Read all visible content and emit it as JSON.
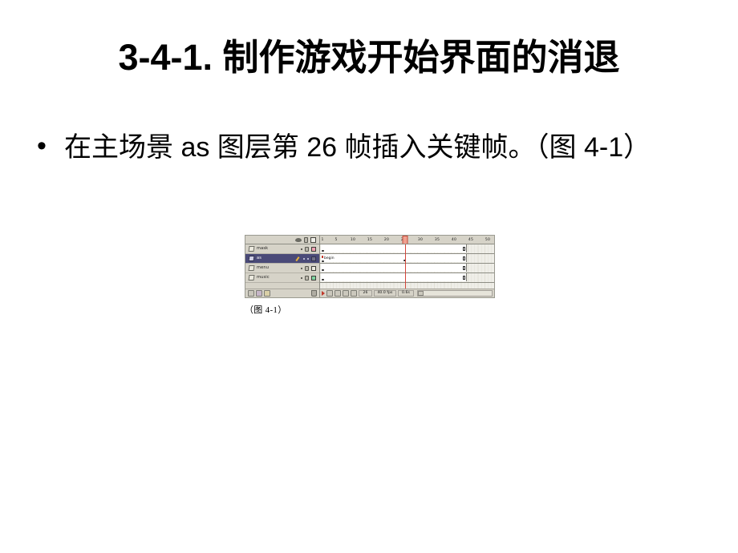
{
  "slide": {
    "title": "3-4-1. 制作游戏开始界面的消退",
    "bullets": [
      {
        "marker": "•",
        "text": "在主场景 as 图层第 26 帧插入关键帧。（图 4-1）"
      }
    ],
    "figure": {
      "caption": "（图 4-1）",
      "alt_name": "flash-timeline-panel"
    }
  },
  "timeline": {
    "column_headers": {
      "eye": "eye-icon",
      "lock": "lock-icon",
      "outline": "outline-square-icon"
    },
    "layers": [
      {
        "name": "mask",
        "selected": false,
        "edit_marker": "dot",
        "visible_dot": "•",
        "locked_icon": "lock-icon",
        "outline_color": "#f3a0b4",
        "span_start": 1,
        "span_end": 45,
        "keyframes": [
          1
        ],
        "empty_keyframes": [],
        "label": ""
      },
      {
        "name": "as",
        "selected": true,
        "edit_marker": "pencil-icon",
        "visible_dot": "•",
        "locked_icon": "dot",
        "outline_color": "#6f6f86",
        "span_start": 1,
        "span_end": 45,
        "keyframes": [
          1,
          26
        ],
        "empty_keyframes": [],
        "label": "begin"
      },
      {
        "name": "menu",
        "selected": false,
        "edit_marker": "dot",
        "visible_dot": "•",
        "locked_icon": "lock-icon",
        "outline_color": "#eceadf",
        "span_start": 1,
        "span_end": 45,
        "keyframes": [
          1
        ],
        "empty_keyframes": [],
        "label": ""
      },
      {
        "name": "music",
        "selected": false,
        "edit_marker": "dot",
        "visible_dot": "•",
        "locked_icon": "lock-icon",
        "outline_color": "#7fd4a0",
        "span_start": 1,
        "span_end": 45,
        "keyframes": [
          1
        ],
        "empty_keyframes": [],
        "label": ""
      }
    ],
    "layer_toolbar": {
      "insert_layer": "insert-layer-icon",
      "add_motion_guide": "add-motion-guide-icon",
      "insert_layer_folder": "insert-layer-folder-icon",
      "delete_layer": "trash-icon"
    },
    "ruler": {
      "ticks": [
        1,
        5,
        10,
        15,
        20,
        25,
        30,
        35,
        40,
        45,
        50
      ],
      "first_frame": 1,
      "last_frame": 52
    },
    "playhead_frame": 26,
    "status_bar": {
      "play_icon": "play-icon",
      "buttons": [
        "center-frame-icon",
        "onion-skin-icon",
        "onion-skin-outlines-icon",
        "edit-multiple-frames-icon",
        "modify-onion-markers-icon"
      ],
      "current_frame": "26",
      "frame_rate": "40.0 fps",
      "elapsed_time": "0.6s",
      "scroll_left_icon": "scroll-left-icon"
    }
  },
  "colors": {
    "page_background": "#ffffff",
    "panel_background": "#d6d3c8",
    "frame_grid": "#efeee8",
    "selected_layer": "#4a4a78",
    "playhead": "#d4453a",
    "text": "#000000"
  }
}
